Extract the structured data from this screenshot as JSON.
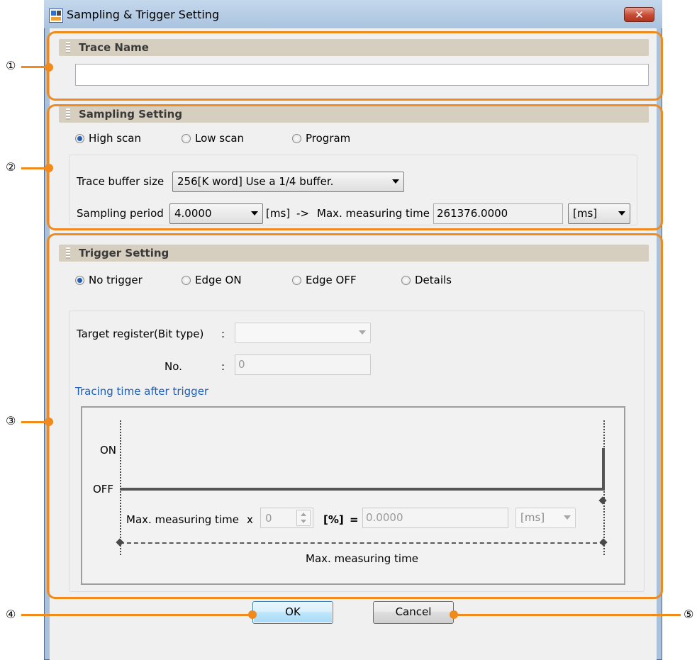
{
  "window": {
    "title": "Sampling & Trigger Setting",
    "close_label": "✕",
    "icon": "app-icon"
  },
  "trace_name": {
    "header": "Trace Name",
    "value": ""
  },
  "sampling": {
    "header": "Sampling Setting",
    "radios": [
      {
        "label": "High scan",
        "checked": true
      },
      {
        "label": "Low scan",
        "checked": false
      },
      {
        "label": "Program",
        "checked": false
      }
    ],
    "buffer_label": "Trace buffer size",
    "buffer_value": "256[K word] Use a 1/4 buffer.",
    "period_label": "Sampling period",
    "period_value": "4.0000",
    "period_unit": "[ms]",
    "arrow_text": "->",
    "max_time_label": "Max. measuring time",
    "max_time_value": "261376.0000",
    "max_time_unit": "[ms]"
  },
  "trigger": {
    "header": "Trigger Setting",
    "radios": [
      {
        "label": "No trigger",
        "checked": true
      },
      {
        "label": "Edge ON",
        "checked": false
      },
      {
        "label": "Edge OFF",
        "checked": false
      },
      {
        "label": "Details",
        "checked": false
      }
    ],
    "target_label": "Target register(Bit type)",
    "target_colon": ":",
    "target_value": "",
    "no_label": "No.",
    "no_colon": ":",
    "no_value": "0",
    "tracing_label": "Tracing time after trigger",
    "chart": {
      "on_label": "ON",
      "off_label": "OFF",
      "max_label": "Max. measuring time",
      "x_sign": "x",
      "percent_value": "0",
      "percent_unit": "[%]",
      "equals": "=",
      "result_value": "0.0000",
      "result_unit": "[ms]",
      "axis_label": "Max. measuring time"
    }
  },
  "buttons": {
    "ok": "OK",
    "cancel": "Cancel"
  },
  "callouts": [
    "①",
    "②",
    "③",
    "④",
    "⑤"
  ],
  "colors": {
    "annotation": "#f08a1c",
    "link_text": "#1f5fb8"
  }
}
